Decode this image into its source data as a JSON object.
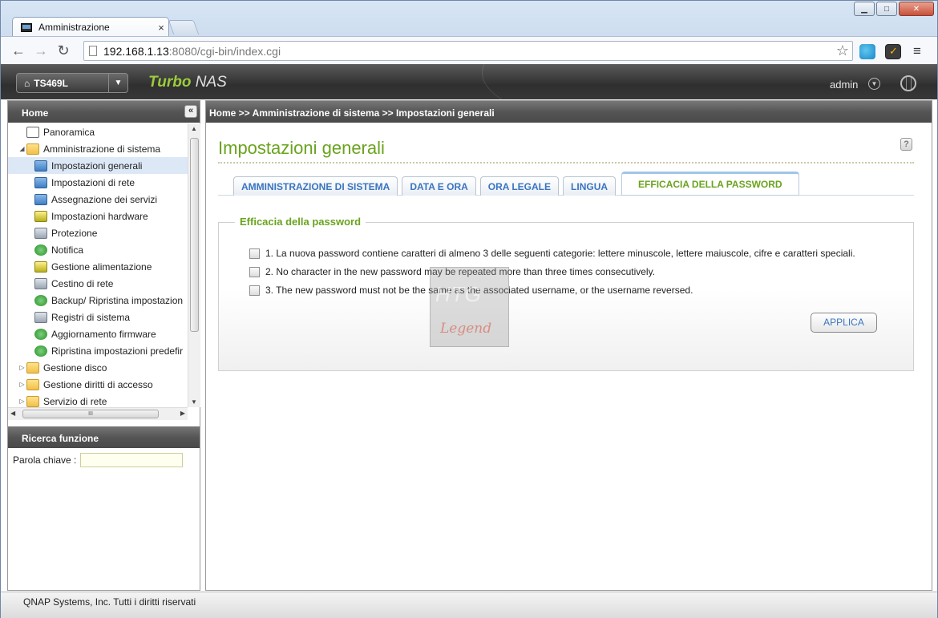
{
  "browser": {
    "tab_title": "Amministrazione",
    "tab_close": "×",
    "url_host": "192.168.1.13",
    "url_rest": ":8080/cgi-bin/index.cgi",
    "back": "←",
    "forward": "→",
    "reload": "↻",
    "star": "☆",
    "menu": "≡",
    "minimize": "▁",
    "maximize": "□",
    "close": "✕"
  },
  "header": {
    "device": "TS469L",
    "device_arrow": "▼",
    "brand_turbo": "Turbo",
    "brand_nas": " NAS",
    "user": "admin",
    "user_arrow": "▼"
  },
  "sidebar": {
    "title": "Home",
    "collapse": "«",
    "items": [
      {
        "label": "Panoramica",
        "icon": "panel-icon",
        "level": 0,
        "twisty": ""
      },
      {
        "label": "Amministrazione di sistema",
        "icon": "folder-open-icon",
        "level": 0,
        "twisty": "◢"
      },
      {
        "label": "Impostazioni generali",
        "icon": "settings-icon",
        "level": 1,
        "selected": true
      },
      {
        "label": "Impostazioni di rete",
        "icon": "network-icon",
        "level": 1
      },
      {
        "label": "Assegnazione dei servizi",
        "icon": "services-icon",
        "level": 1
      },
      {
        "label": "Impostazioni hardware",
        "icon": "hardware-icon",
        "level": 1
      },
      {
        "label": "Protezione",
        "icon": "protection-icon",
        "level": 1
      },
      {
        "label": "Notifica",
        "icon": "notification-icon",
        "level": 1
      },
      {
        "label": "Gestione alimentazione",
        "icon": "power-icon",
        "level": 1
      },
      {
        "label": "Cestino di rete",
        "icon": "recycle-bin-icon",
        "level": 1
      },
      {
        "label": "Backup/ Ripristina impostazion",
        "icon": "backup-icon",
        "level": 1
      },
      {
        "label": "Registri di sistema",
        "icon": "logs-icon",
        "level": 1
      },
      {
        "label": "Aggiornamento firmware",
        "icon": "firmware-icon",
        "level": 1
      },
      {
        "label": "Ripristina impostazioni predefir",
        "icon": "restore-icon",
        "level": 1
      },
      {
        "label": "Gestione disco",
        "icon": "folder-icon",
        "level": 0,
        "twisty": "▷"
      },
      {
        "label": "Gestione diritti di accesso",
        "icon": "folder-icon",
        "level": 0,
        "twisty": "▷"
      },
      {
        "label": "Servizio di rete",
        "icon": "folder-icon",
        "level": 0,
        "twisty": "▷"
      }
    ],
    "scroll_up": "▲",
    "scroll_down": "▼",
    "scroll_left": "◀",
    "scroll_right": "▶",
    "hscroll_grip": "III",
    "search_title": "Ricerca funzione",
    "search_label": "Parola chiave :"
  },
  "main": {
    "breadcrumb": "Home >> Amministrazione di sistema >> Impostazioni generali",
    "title": "Impostazioni generali",
    "help": "?",
    "tabs": [
      {
        "label": "AMMINISTRAZIONE DI SISTEMA",
        "active": false
      },
      {
        "label": "DATA E ORA",
        "active": false
      },
      {
        "label": "ORA LEGALE",
        "active": false
      },
      {
        "label": "LINGUA",
        "active": false
      },
      {
        "label": "EFFICACIA DELLA PASSWORD",
        "active": true
      }
    ],
    "legend": "Efficacia della password",
    "options": [
      "1. La nuova password contiene caratteri di almeno 3 delle seguenti categorie: lettere minuscole, lettere maiuscole, cifre e caratteri speciali.",
      "2. No character in the new password may be repeated more than three times consecutively.",
      "3. The new password must not be the same as the associated username, or the username reversed."
    ],
    "apply": "APPLICA",
    "watermark_top": "HTG",
    "watermark_bottom": "Legend"
  },
  "footer": {
    "text": "QNAP Systems, Inc. Tutti i diritti riservati"
  }
}
